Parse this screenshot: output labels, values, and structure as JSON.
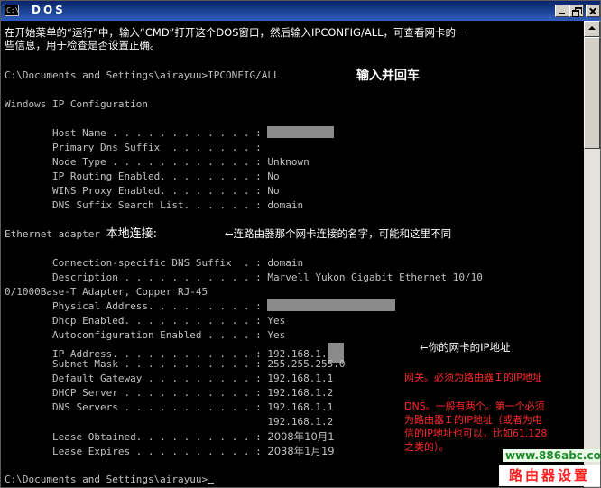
{
  "window": {
    "title": "DOS",
    "icon": "console-icon",
    "icon_text": "C:\\"
  },
  "intro": {
    "line1": "在开始菜单的“运行”中，输入“CMD”打开这个DOS窗口，然后输入IPCONFIG/ALL，可查看网卡的一",
    "line2": "些信息，用于检查是否设置正确。"
  },
  "prompt1": {
    "text": "C:\\Documents and Settings\\airayuu>IPCONFIG/ALL",
    "note": "输入并回车"
  },
  "header": "Windows IP Configuration",
  "host_config": [
    {
      "label": "        Host Name . . . . . . . . . . . . : ",
      "value": "",
      "masked": true
    },
    {
      "label": "        Primary Dns Suffix  . . . . . . . : ",
      "value": ""
    },
    {
      "label": "        Node Type . . . . . . . . . . . . : ",
      "value": "Unknown"
    },
    {
      "label": "        IP Routing Enabled. . . . . . . . : ",
      "value": "No"
    },
    {
      "label": "        WINS Proxy Enabled. . . . . . . . : ",
      "value": "No"
    },
    {
      "label": "        DNS Suffix Search List. . . . . . : ",
      "value": "domain"
    }
  ],
  "adapter": {
    "prefix": "Ethernet adapter ",
    "name": "本地连接:",
    "note": "←连路由器那个网卡连接的名字，可能和这里不同"
  },
  "adapter_config": {
    "conn_suffix_label": "        Connection-specific DNS Suffix  . : ",
    "conn_suffix_value": "domain",
    "description_label": "        Description . . . . . . . . . . . : ",
    "description_value": "Marvell Yukon Gigabit Ethernet 10/10",
    "description_wrap": "0/1000Base-T Adapter, Copper RJ-45",
    "physical_label": "        Physical Address. . . . . . . . . : ",
    "dhcp_label": "        Dhcp Enabled. . . . . . . . . . . : ",
    "dhcp_value": "Yes",
    "autoconf_label": "        Autoconfiguration Enabled . . . . : ",
    "autoconf_value": "Yes",
    "ip_label": "        IP Address. . . . . . . . . . . . : ",
    "ip_value": "192.168.1.",
    "ip_note": "←你的网卡的IP地址",
    "subnet_label": "        Subnet Mask . . . . . . . . . . . : ",
    "subnet_value": "255.255.255.0",
    "gateway_label": "        Default Gateway . . . . . . . . . : ",
    "gateway_value": "192.168.1.1",
    "gateway_note": "网关。必须为路由器Ｉ的IP地址",
    "dhcp_server_label": "        DHCP Server . . . . . . . . . . . : ",
    "dhcp_server_value": "192.168.1.2",
    "dns_label": "        DNS Servers . . . . . . . . . . . : ",
    "dns_value1": "192.168.1.1",
    "dns_value2_indent": "                                            ",
    "dns_value2": "192.168.1.2",
    "dns_note": "DNS。一般有两个。第一个必须\n为路由器Ｉ的IP地址（或者为电\n信的IP地址也可以，比如61.128\n之类的）。",
    "lease_obtained_label": "        Lease Obtained. . . . . . . . . . : ",
    "lease_obtained_value": "2008年10月1",
    "lease_expires_label": "        Lease Expires . . . . . . . . . . : ",
    "lease_expires_value": "2038年1月19"
  },
  "prompt2": "C:\\Documents and Settings\\airayuu>",
  "watermark": {
    "url": "www.886abc.com",
    "name": "路由器设置"
  },
  "colors": {
    "console_bg": "#000000",
    "console_text": "#c0c0c0",
    "note_red": "#ff2a2a",
    "titlebar": "#0a246a",
    "watermark_green": "#1d8b2a"
  }
}
